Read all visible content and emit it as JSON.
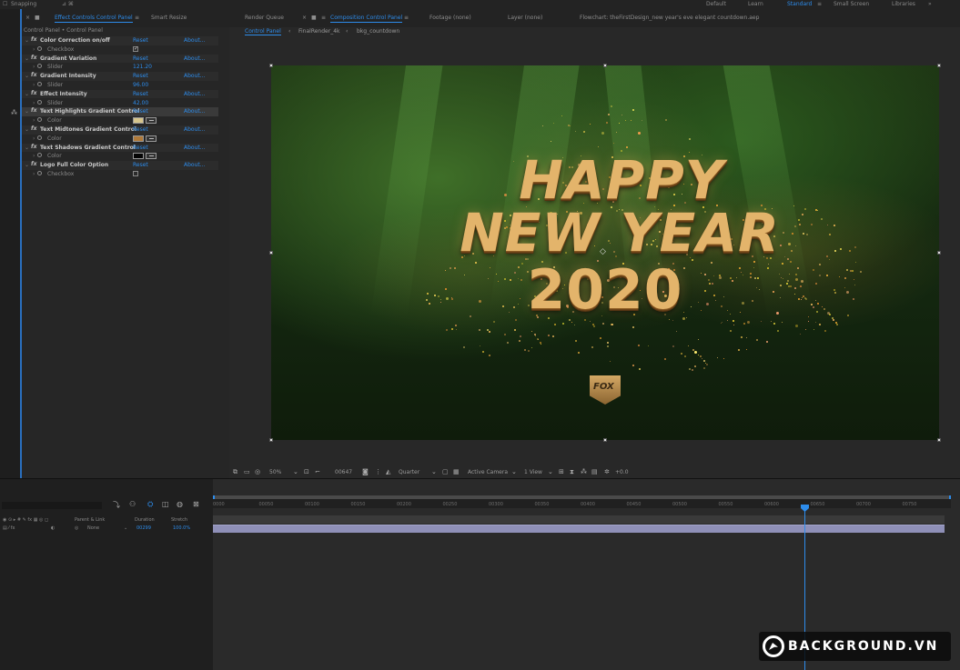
{
  "topbar": {
    "snapping": "Snapping",
    "workspaces": [
      "Default",
      "Learn",
      "Standard",
      "Small Screen",
      "Libraries"
    ],
    "active_workspace": "Standard"
  },
  "effects_panel": {
    "tab_effect_controls": "Effect Controls",
    "tab_effect_controls_layer": "Control Panel",
    "tab_smart_resize": "Smart Resize",
    "path": "Control Panel • Control Panel",
    "fx_symbol": "fx",
    "reset": "Reset",
    "about": "About...",
    "effects": [
      {
        "name": "Color Correction on/off",
        "param": "Checkbox",
        "type": "checkbox",
        "checked": true
      },
      {
        "name": "Gradient Variation",
        "param": "Slider",
        "type": "slider",
        "value": "121.20"
      },
      {
        "name": "Gradient Intensity",
        "param": "Slider",
        "type": "slider",
        "value": "96.00"
      },
      {
        "name": "Effect Intensity",
        "param": "Slider",
        "type": "slider",
        "value": "42.00"
      },
      {
        "name": "Text Highlights Gradient Control",
        "param": "Color",
        "type": "color",
        "color": "#d6c58c"
      },
      {
        "name": "Text Midtones Gradient Control",
        "param": "Color",
        "type": "color",
        "color": "#b07a3a"
      },
      {
        "name": "Text Shadows Gradient Control",
        "param": "Color",
        "type": "color",
        "color": "#050505"
      },
      {
        "name": "Logo Full Color Option",
        "param": "Checkbox",
        "type": "checkbox",
        "checked": false
      }
    ]
  },
  "comp_panel": {
    "tab_render_queue": "Render Queue",
    "tab_composition": "Composition",
    "tab_composition_name": "Control Panel",
    "tab_footage": "Footage (none)",
    "tab_layer": "Layer (none)",
    "file_title": "Flowchart: theFirstDesign_new year's eve elegant countdown.aep",
    "breadcrumb": [
      "Control Panel",
      "FinalRender_4k",
      "bkg_countdown"
    ],
    "viewer_text": {
      "line1": "HAPPY",
      "line2": "NEW YEAR",
      "line3": "2020",
      "logo": "FOX"
    },
    "toolbar": {
      "zoom": "50%",
      "timecode": "00647",
      "resolution": "Quarter",
      "camera": "Active Camera",
      "views": "1 View",
      "exposure": "+0.0"
    }
  },
  "timeline": {
    "columns": {
      "parent_link": "Parent & Link",
      "duration": "Duration",
      "stretch": "Stretch"
    },
    "layer": {
      "parent": "None",
      "duration": "00299",
      "stretch": "100.0%"
    },
    "ruler_ticks": [
      "0000",
      "00050",
      "00100",
      "00150",
      "00200",
      "00250",
      "00300",
      "00350",
      "00400",
      "00450",
      "00500",
      "00550",
      "00600",
      "00650",
      "00700",
      "00750"
    ]
  },
  "watermark": {
    "text": "BACKGROUND.VN"
  },
  "colors": {
    "accent": "#2d8ceb",
    "layer_bar": "#8f90b8",
    "title_gold": "#e3b46b"
  }
}
